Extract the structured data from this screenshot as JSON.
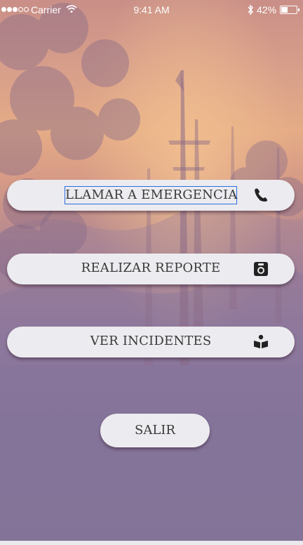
{
  "status_bar": {
    "carrier": "Carrier",
    "time": "9:41 AM",
    "battery_percent_label": "42%",
    "battery_level": 0.42,
    "signal_bars_filled": 3,
    "signal_bars_total": 5
  },
  "menu": {
    "call_label": "LLAMAR A EMERGENCIA",
    "report_label": "REALIZAR REPORTE",
    "incidents_label": "VER INCIDENTES",
    "exit_label": "SALIR"
  },
  "icons": {
    "call": "phone-icon",
    "report": "camera-icon",
    "incidents": "book-reader-icon"
  },
  "colors": {
    "button_bg": "#ecebef",
    "button_text": "#3a3a3a",
    "focus_outline": "#2a6fe0"
  }
}
